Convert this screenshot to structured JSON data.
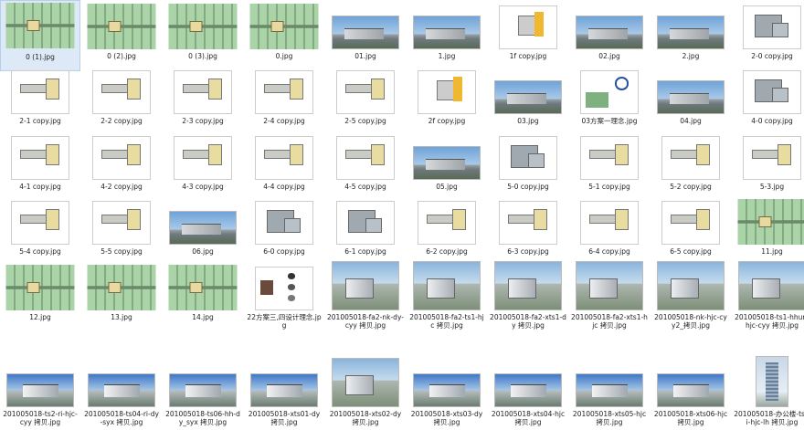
{
  "files": [
    {
      "name": "0 (1).jpg",
      "kind": "map",
      "selected": true
    },
    {
      "name": "0 (2).jpg",
      "kind": "map"
    },
    {
      "name": "0 (3).jpg",
      "kind": "map"
    },
    {
      "name": "0.jpg",
      "kind": "map"
    },
    {
      "name": "01.jpg",
      "kind": "photo"
    },
    {
      "name": "1.jpg",
      "kind": "photo"
    },
    {
      "name": "1f copy.jpg",
      "kind": "planY"
    },
    {
      "name": "02.jpg",
      "kind": "photo"
    },
    {
      "name": "2.jpg",
      "kind": "photo"
    },
    {
      "name": "2-0 copy.jpg",
      "kind": "plan2"
    },
    {
      "name": "2-1 copy.jpg",
      "kind": "plan"
    },
    {
      "name": "2-2 copy.jpg",
      "kind": "plan"
    },
    {
      "name": "2-3 copy.jpg",
      "kind": "plan"
    },
    {
      "name": "2-4 copy.jpg",
      "kind": "plan"
    },
    {
      "name": "2-5 copy.jpg",
      "kind": "plan"
    },
    {
      "name": "2f copy.jpg",
      "kind": "planY"
    },
    {
      "name": "03.jpg",
      "kind": "photo"
    },
    {
      "name": "03方案一理念.jpg",
      "kind": "concept"
    },
    {
      "name": "04.jpg",
      "kind": "photo"
    },
    {
      "name": "4-0 copy.jpg",
      "kind": "plan2"
    },
    {
      "name": "4-1 copy.jpg",
      "kind": "plan"
    },
    {
      "name": "4-2 copy.jpg",
      "kind": "plan"
    },
    {
      "name": "4-3 copy.jpg",
      "kind": "plan"
    },
    {
      "name": "4-4 copy.jpg",
      "kind": "plan"
    },
    {
      "name": "4-5 copy.jpg",
      "kind": "plan"
    },
    {
      "name": "05.jpg",
      "kind": "photo"
    },
    {
      "name": "5-0 copy.jpg",
      "kind": "plan2"
    },
    {
      "name": "5-1 copy.jpg",
      "kind": "plan"
    },
    {
      "name": "5-2 copy.jpg",
      "kind": "plan"
    },
    {
      "name": "5-3.jpg",
      "kind": "plan"
    },
    {
      "name": "5-4 copy.jpg",
      "kind": "plan"
    },
    {
      "name": "5-5 copy.jpg",
      "kind": "plan"
    },
    {
      "name": "06.jpg",
      "kind": "photo"
    },
    {
      "name": "6-0 copy.jpg",
      "kind": "plan2"
    },
    {
      "name": "6-1 copy.jpg",
      "kind": "plan2"
    },
    {
      "name": "6-2 copy.jpg",
      "kind": "plan"
    },
    {
      "name": "6-3 copy.jpg",
      "kind": "plan"
    },
    {
      "name": "6-4 copy.jpg",
      "kind": "plan"
    },
    {
      "name": "6-5 copy.jpg",
      "kind": "plan"
    },
    {
      "name": "11.jpg",
      "kind": "map"
    },
    {
      "name": "12.jpg",
      "kind": "map"
    },
    {
      "name": "13.jpg",
      "kind": "map"
    },
    {
      "name": "14.jpg",
      "kind": "map"
    },
    {
      "name": "22方案三,四设计理念.jpg",
      "kind": "doc"
    },
    {
      "name": "201005018-fa2-nk-dy-cyy 拷贝.jpg",
      "kind": "render"
    },
    {
      "name": "201005018-fa2-ts1-hjc 拷贝.jpg",
      "kind": "render"
    },
    {
      "name": "201005018-fa2-xts1-dy 拷贝.jpg",
      "kind": "render"
    },
    {
      "name": "201005018-fa2-xts1-hjc 拷贝.jpg",
      "kind": "render"
    },
    {
      "name": "201005018-nk-hjc-cyy2_拷贝.jpg",
      "kind": "render"
    },
    {
      "name": "201005018-ts1-hhun-hjc-cyy 拷贝.jpg",
      "kind": "render"
    },
    {
      "name": "201005018-ts2-ri-hjc-cyy 拷贝.jpg",
      "kind": "renderS"
    },
    {
      "name": "201005018-ts04-ri-dy-syx 拷贝.jpg",
      "kind": "renderS"
    },
    {
      "name": "201005018-ts06-hh-dy_syx 拷贝.jpg",
      "kind": "renderS"
    },
    {
      "name": "201005018-xts01-dy 拷贝.jpg",
      "kind": "renderS"
    },
    {
      "name": "201005018-xts02-dy 拷贝.jpg",
      "kind": "render"
    },
    {
      "name": "201005018-xts03-dy 拷贝.jpg",
      "kind": "renderS"
    },
    {
      "name": "201005018-xts04-hjc 拷贝.jpg",
      "kind": "renderS"
    },
    {
      "name": "201005018-xts05-hjc 拷贝.jpg",
      "kind": "renderS"
    },
    {
      "name": "201005018-xts06-hjc 拷贝.jpg",
      "kind": "renderS"
    },
    {
      "name": "201005018-办公楼-ts-ri-hjc-lh 拷贝.jpg",
      "kind": "tower"
    }
  ]
}
